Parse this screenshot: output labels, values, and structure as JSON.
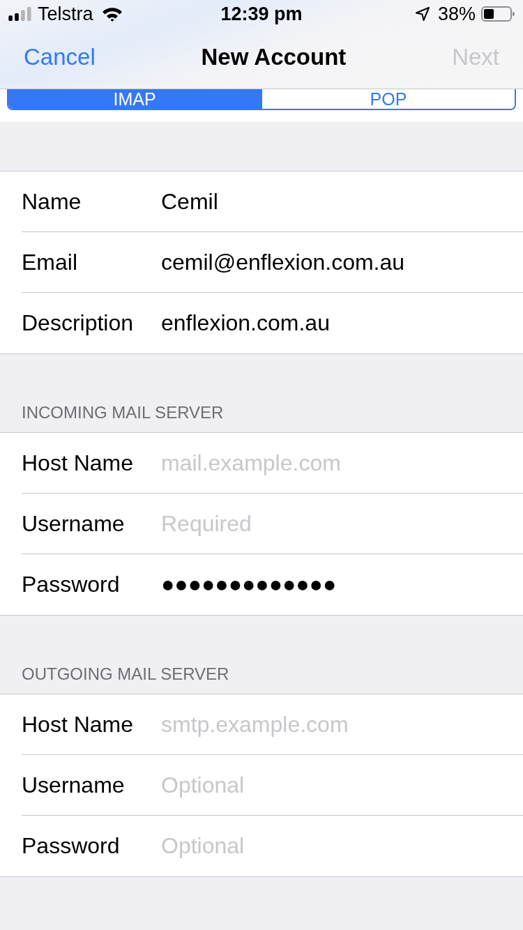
{
  "status_bar": {
    "carrier": "Telstra",
    "time": "12:39 pm",
    "battery": "38%"
  },
  "nav_bar": {
    "cancel": "Cancel",
    "title": "New Account",
    "next": {
      "label": "Next",
      "disabled": true
    }
  },
  "segments": [
    {
      "label": "IMAP",
      "selected": true
    },
    {
      "label": "POP",
      "selected": false
    }
  ],
  "sections": [
    {
      "fields": [
        {
          "label": "Name",
          "value": "Cemil"
        },
        {
          "label": "Email",
          "value": "cemil@enflexion.com.au"
        },
        {
          "label": "Description",
          "value": "enflexion.com.au"
        }
      ]
    },
    {
      "header": "INCOMING MAIL SERVER",
      "fields": [
        {
          "label": "Host Name",
          "placeholder": "mail.example.com"
        },
        {
          "label": "Username",
          "placeholder": "Required"
        },
        {
          "label": "Password",
          "value": "●●●●●●●●●●●●●"
        }
      ]
    },
    {
      "header": "OUTGOING MAIL SERVER",
      "fields": [
        {
          "label": "Host Name",
          "placeholder": "smtp.example.com"
        },
        {
          "label": "Username",
          "placeholder": "Optional"
        },
        {
          "label": "Password",
          "placeholder": "Optional"
        }
      ]
    }
  ]
}
